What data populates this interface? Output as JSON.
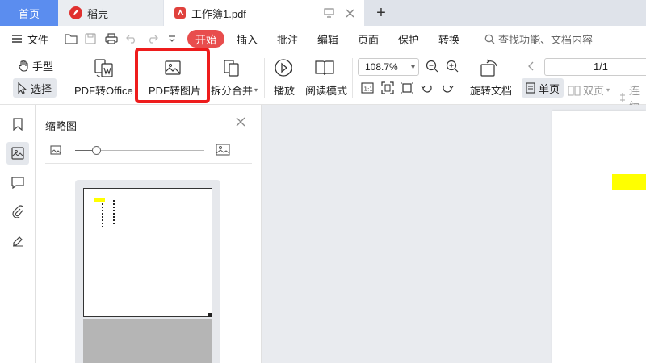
{
  "tabs": {
    "home": "首页",
    "daoke": "稻壳",
    "doc": "工作簿1.pdf",
    "add": "+"
  },
  "menubar": {
    "file": "文件",
    "start": "开始",
    "items": [
      "插入",
      "批注",
      "编辑",
      "页面",
      "保护",
      "转换"
    ],
    "search": "查找功能、文档内容"
  },
  "toolbar": {
    "hand": "手型",
    "select": "选择",
    "pdf_to_office": "PDF转Office",
    "pdf_to_image": "PDF转图片",
    "split_merge": "拆分合并",
    "play": "播放",
    "read_mode": "阅读模式",
    "zoom": "108.7%",
    "rotate": "旋转文档",
    "page": "1/1",
    "single": "单页",
    "double": "双页",
    "continuous": "连续"
  },
  "thumbnails": {
    "title": "缩略图",
    "zoom_level": 0.14
  },
  "colors": {
    "accent": "#5b8def",
    "start_red": "#e84d4d",
    "highlight_red": "#ee1c1c",
    "doc_yellow": "#ffff00"
  }
}
